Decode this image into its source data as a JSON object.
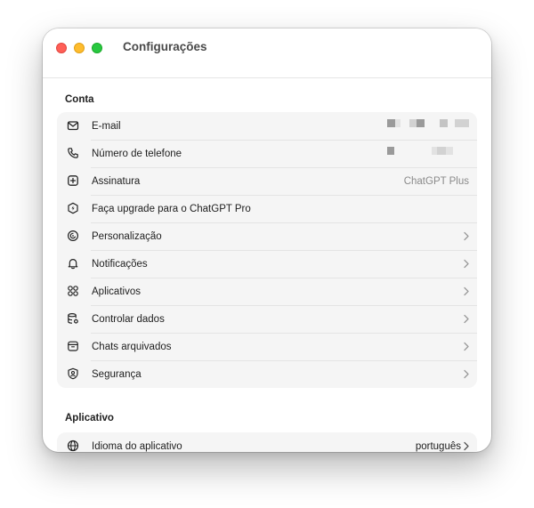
{
  "window": {
    "title": "Configurações"
  },
  "sections": {
    "account": {
      "title": "Conta",
      "rows": {
        "email": {
          "label": "E-mail",
          "icon": "mail-icon"
        },
        "phone": {
          "label": "Número de telefone",
          "icon": "phone-icon"
        },
        "subscription": {
          "label": "Assinatura",
          "value": "ChatGPT Plus",
          "icon": "plus-square-icon"
        },
        "upgrade": {
          "label": "Faça upgrade para o ChatGPT Pro",
          "icon": "upgrade-shield-icon"
        },
        "personalization": {
          "label": "Personalização",
          "icon": "personalization-icon"
        },
        "notifications": {
          "label": "Notificações",
          "icon": "bell-icon"
        },
        "apps": {
          "label": "Aplicativos",
          "icon": "apps-grid-icon"
        },
        "data_controls": {
          "label": "Controlar dados",
          "icon": "data-controls-icon"
        },
        "archived": {
          "label": "Chats arquivados",
          "icon": "archive-box-icon"
        },
        "security": {
          "label": "Segurança",
          "icon": "security-shield-icon"
        }
      }
    },
    "app": {
      "title": "Aplicativo",
      "rows": {
        "language": {
          "label": "Idioma do aplicativo",
          "value": "português",
          "icon": "globe-icon"
        }
      }
    }
  },
  "colors": {
    "close": "#ff5f57",
    "minimize": "#febc2e",
    "maximize": "#28c840",
    "group_background": "#f5f5f5"
  }
}
